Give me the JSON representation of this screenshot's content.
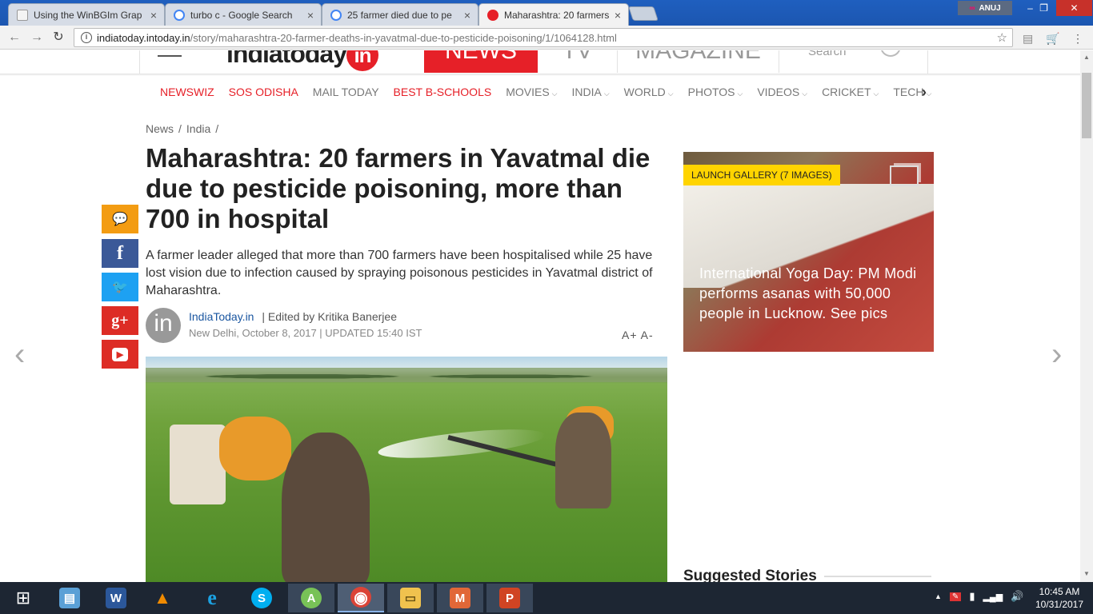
{
  "browser": {
    "tabs": [
      {
        "label": "Using the WinBGIm Grap",
        "icon_color": "#f4f4f4"
      },
      {
        "label": "turbo c - Google Search",
        "icon_color": "#4285f4"
      },
      {
        "label": "25 farmer died due to pe",
        "icon_color": "#4285f4"
      },
      {
        "label": "Maharashtra: 20 farmers",
        "icon_color": "#e62028"
      }
    ],
    "profile_name": "ANUJ",
    "url_domain": "indiatoday.intoday.in",
    "url_path": "/story/maharashtra-20-farmer-deaths-in-yavatmal-due-to-pesticide-poisoning/1/1064128.html"
  },
  "masthead": {
    "logo_text": "indiatoday",
    "logo_badge": "in",
    "news": "NEWS",
    "tv": "TV",
    "magazine": "MAGAZINE",
    "search": "Search"
  },
  "nav": [
    {
      "label": "NEWSWIZ",
      "highlight": true,
      "chevron": ""
    },
    {
      "label": "SOS ODISHA",
      "highlight": true,
      "chevron": ""
    },
    {
      "label": "MAIL TODAY",
      "highlight": false,
      "chevron": ""
    },
    {
      "label": "BEST B-SCHOOLS",
      "highlight": true,
      "chevron": ""
    },
    {
      "label": "MOVIES",
      "highlight": false,
      "chevron": "⌵"
    },
    {
      "label": "INDIA",
      "highlight": false,
      "chevron": "⌵"
    },
    {
      "label": "WORLD",
      "highlight": false,
      "chevron": "⌵"
    },
    {
      "label": "PHOTOS",
      "highlight": false,
      "chevron": "⌵"
    },
    {
      "label": "VIDEOS",
      "highlight": false,
      "chevron": "⌵"
    },
    {
      "label": "CRICKET",
      "highlight": false,
      "chevron": "⌵"
    },
    {
      "label": "TECH",
      "highlight": false,
      "chevron": "⌵"
    }
  ],
  "breadcrumb": [
    "News",
    "/",
    "India",
    "/"
  ],
  "article": {
    "headline": "Maharashtra: 20 farmers in Yavatmal die due to pesticide poisoning, more than 700 in hospital",
    "summary": "A farmer leader alleged that more than 700 farmers have been hospitalised while 25 have lost vision due to infection caused by spraying poisonous pesticides in Yavatmal district of Maharashtra.",
    "source": "IndiaToday.in",
    "editor": "| Edited by Kritika Banerjee",
    "dateline": "New Delhi, October 8, 2017 | UPDATED 15:40 IST",
    "font_size_controls": "A+ A-",
    "avatar_text": "in"
  },
  "share": [
    {
      "name": "comment-icon",
      "glyph": "💬",
      "color": "#f39c12"
    },
    {
      "name": "facebook-icon",
      "glyph": "f",
      "color": "#3b5998"
    },
    {
      "name": "twitter-icon",
      "glyph": "🐦",
      "color": "#1da1f2"
    },
    {
      "name": "google-plus-icon",
      "glyph": "g+",
      "color": "#dd2c25"
    },
    {
      "name": "youtube-icon",
      "glyph": "▶",
      "color": "#dd2c25"
    }
  ],
  "gallery": {
    "badge": "LAUNCH GALLERY (7 IMAGES)",
    "caption": "International Yoga Day: PM Modi performs asanas with 50,000 people in Lucknow. See pics"
  },
  "suggested_title": "Suggested Stories",
  "taskbar": {
    "apps": [
      {
        "name": "start-button",
        "glyph": "⊞",
        "color": "#1d2633"
      },
      {
        "name": "file-manager-icon",
        "glyph": "▤",
        "color": "#5aa0d6"
      },
      {
        "name": "word-icon",
        "glyph": "W",
        "color": "#2b579a"
      },
      {
        "name": "vlc-icon",
        "glyph": "▲",
        "color": "#f08a00"
      },
      {
        "name": "internet-explorer-icon",
        "glyph": "e",
        "color": "#1ba1e2"
      },
      {
        "name": "skype-icon",
        "glyph": "S",
        "color": "#00aff0"
      },
      {
        "name": "android-studio-icon",
        "glyph": "A",
        "color": "#78c257"
      },
      {
        "name": "chrome-icon",
        "glyph": "◉",
        "color": "#db4437"
      },
      {
        "name": "explorer-icon",
        "glyph": "▭",
        "color": "#f0c24e"
      },
      {
        "name": "matlab-icon",
        "glyph": "M",
        "color": "#e16737"
      },
      {
        "name": "powerpoint-icon",
        "glyph": "P",
        "color": "#d04423"
      }
    ],
    "time": "10:45 AM",
    "date": "10/31/2017"
  }
}
